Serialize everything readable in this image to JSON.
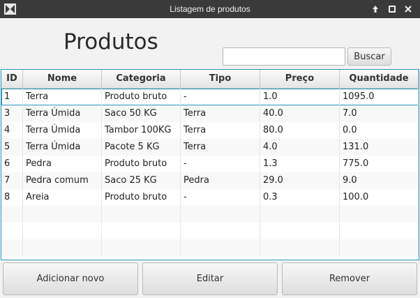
{
  "window": {
    "title": "Listagem de produtos",
    "app_icon": "app-logo-icon",
    "controls": [
      "maximize-up-icon",
      "restore-icon",
      "close-icon"
    ]
  },
  "header": {
    "title": "Produtos"
  },
  "search": {
    "value": "",
    "placeholder": "",
    "button_label": "Buscar"
  },
  "table": {
    "columns": [
      "ID",
      "Nome",
      "Categoria",
      "Tipo",
      "Preço",
      "Quantidade"
    ],
    "rows": [
      [
        "1",
        "Terra",
        "Produto bruto",
        "-",
        "1.0",
        "1095.0"
      ],
      [
        "3",
        "Terra Úmida",
        "Saco 50 KG",
        "Terra",
        "40.0",
        "7.0"
      ],
      [
        "4",
        "Terra Úmida",
        "Tambor 100KG",
        "Terra",
        "80.0",
        "0.0"
      ],
      [
        "5",
        "Terra Úmida",
        "Pacote 5 KG",
        "Terra",
        "4.0",
        "131.0"
      ],
      [
        "6",
        "Pedra",
        "Produto bruto",
        "-",
        "1.3",
        "775.0"
      ],
      [
        "7",
        "Pedra comum",
        "Saco 25 KG",
        "Pedra",
        "29.0",
        "9.0"
      ],
      [
        "8",
        "Areia",
        "Produto bruto",
        "-",
        "0.3",
        "100.0"
      ]
    ],
    "selected_row": 0,
    "selection_color": "#2a98bd"
  },
  "actions": {
    "add_label": "Adicionar novo",
    "edit_label": "Editar",
    "remove_label": "Remover"
  }
}
